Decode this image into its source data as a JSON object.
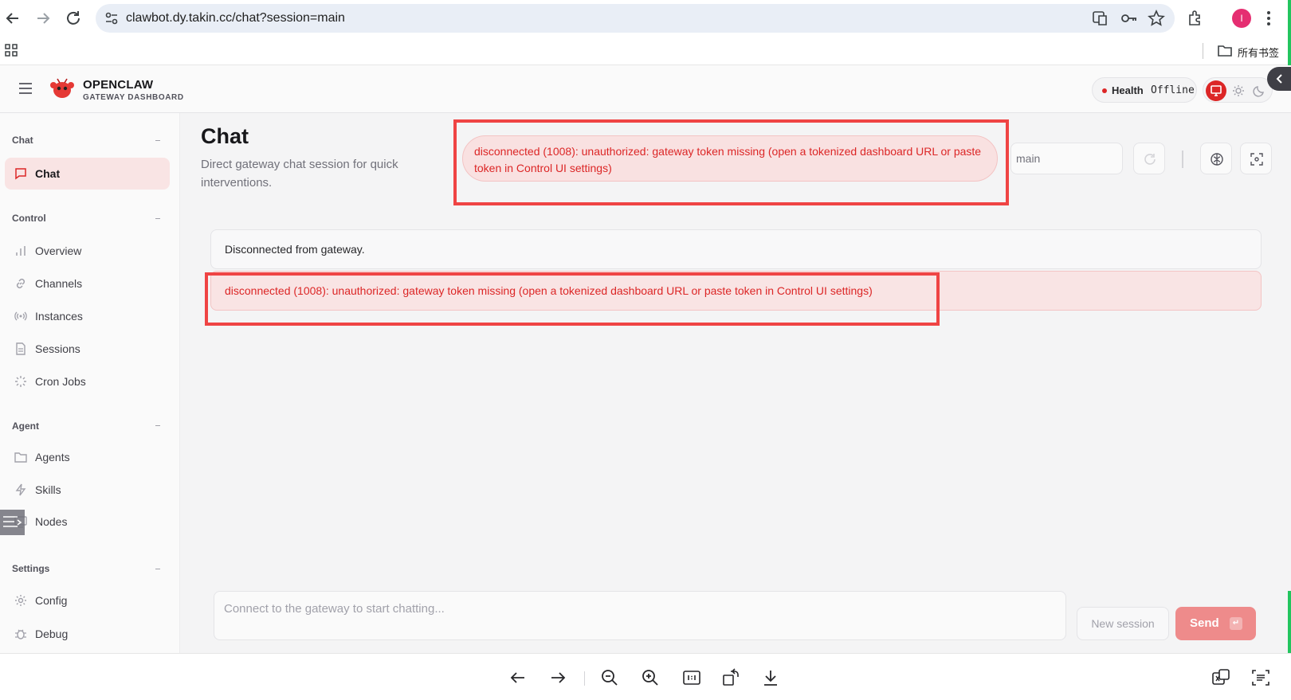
{
  "browser": {
    "url": "clawbot.dy.takin.cc/chat?session=main",
    "avatar_initial": "I",
    "bookmarks_label": "所有书签"
  },
  "header": {
    "brand_name": "OPENCLAW",
    "brand_sub": "GATEWAY DASHBOARD",
    "health_label": "Health",
    "health_value": "Offline"
  },
  "sidebar": {
    "sections": [
      {
        "title": "Chat",
        "items": [
          {
            "label": "Chat",
            "icon": "chat-bubble-icon",
            "active": true
          }
        ]
      },
      {
        "title": "Control",
        "items": [
          {
            "label": "Overview",
            "icon": "bar-chart-icon"
          },
          {
            "label": "Channels",
            "icon": "link-icon"
          },
          {
            "label": "Instances",
            "icon": "radio-signal-icon"
          },
          {
            "label": "Sessions",
            "icon": "document-icon"
          },
          {
            "label": "Cron Jobs",
            "icon": "spinner-icon"
          }
        ]
      },
      {
        "title": "Agent",
        "items": [
          {
            "label": "Agents",
            "icon": "folder-icon"
          },
          {
            "label": "Skills",
            "icon": "lightning-icon"
          },
          {
            "label": "Nodes",
            "icon": "monitor-icon"
          }
        ]
      },
      {
        "title": "Settings",
        "items": [
          {
            "label": "Config",
            "icon": "gear-icon"
          },
          {
            "label": "Debug",
            "icon": "bug-icon"
          }
        ]
      }
    ]
  },
  "main": {
    "title": "Chat",
    "subtitle": "Direct gateway chat session for quick interventions.",
    "error_banner": "disconnected (1008): unauthorized: gateway token missing (open a tokenized dashboard URL or paste token in Control UI settings)",
    "session_value": "main",
    "messages": [
      {
        "type": "info",
        "text": "Disconnected from gateway."
      },
      {
        "type": "error",
        "text": "disconnected (1008): unauthorized: gateway token missing (open a tokenized dashboard URL or paste token in Control UI settings)"
      }
    ],
    "composer_placeholder": "Connect to the gateway to start chatting...",
    "new_session_label": "New session",
    "send_label": "Send",
    "send_kbd": "↵"
  },
  "colors": {
    "accent": "#dc2626",
    "send_bg": "#ee8b8b",
    "active_nav_bg": "#f9e4e4",
    "highlight_border": "#ef4444",
    "edge_green": "#22c55e"
  }
}
